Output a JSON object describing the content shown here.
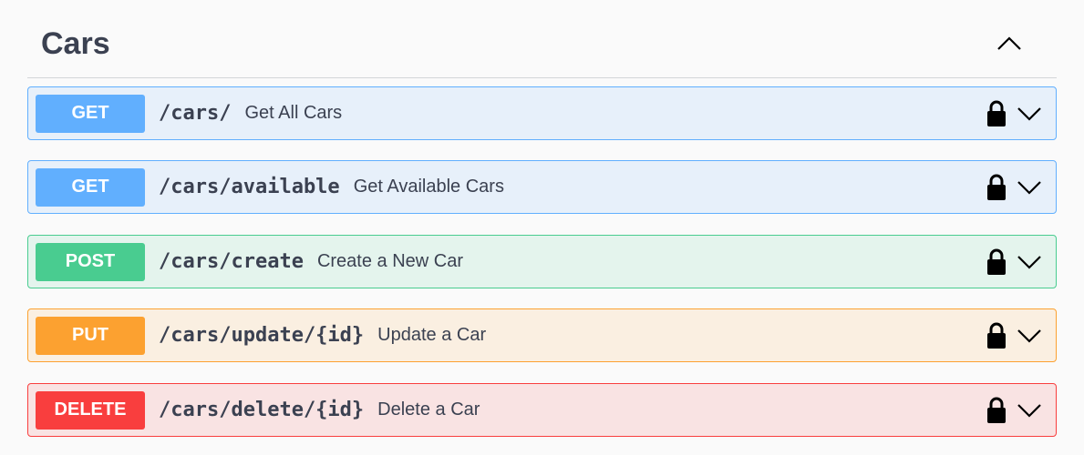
{
  "section": {
    "title": "Cars",
    "collapse_icon": "chevron-up-icon"
  },
  "operations": [
    {
      "method": "GET",
      "path": "/cars/",
      "summary": "Get All Cars",
      "color": "#61affe"
    },
    {
      "method": "GET",
      "path": "/cars/available",
      "summary": "Get Available Cars",
      "color": "#61affe"
    },
    {
      "method": "POST",
      "path": "/cars/create",
      "summary": "Create a New Car",
      "color": "#49cc90"
    },
    {
      "method": "PUT",
      "path": "/cars/update/{id}",
      "summary": "Update a Car",
      "color": "#fca130"
    },
    {
      "method": "DELETE",
      "path": "/cars/delete/{id}",
      "summary": "Delete a Car",
      "color": "#f93e3e"
    }
  ],
  "icons": {
    "lock": "lock-icon",
    "expand": "chevron-down-icon"
  }
}
